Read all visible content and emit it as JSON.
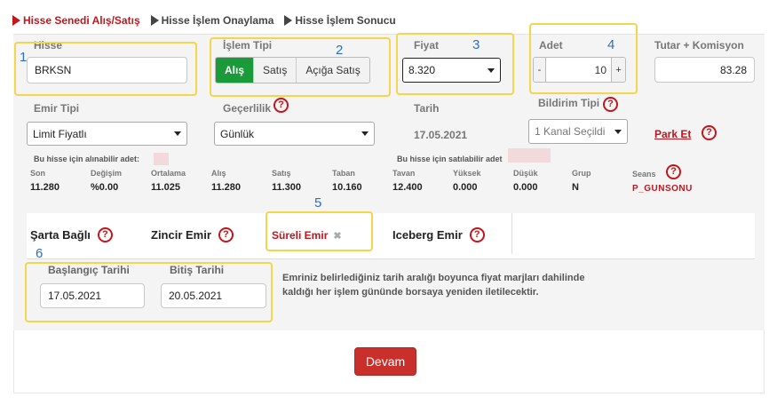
{
  "steps": [
    {
      "label": "Hisse Senedi Alış/Satış"
    },
    {
      "label": "Hisse İşlem Onaylama"
    },
    {
      "label": "Hisse İşlem Sonucu"
    }
  ],
  "form": {
    "hisse_label": "Hisse",
    "hisse_value": "BRKSN",
    "islem_tipi_label": "İşlem Tipi",
    "islem_tipi_options": [
      "Alış",
      "Satış",
      "Açığa Satış"
    ],
    "fiyat_label": "Fiyat",
    "fiyat_value": "8.320",
    "adet_label": "Adet",
    "adet_value": "10",
    "adet_minus": "-",
    "adet_plus": "+",
    "tutar_label": "Tutar + Komisyon",
    "tutar_value": "83.28",
    "emir_tipi_label": "Emir Tipi",
    "emir_tipi_value": "Limit Fiyatlı",
    "gecerlilik_label": "Geçerlilik",
    "gecerlilik_value": "Günlük",
    "tarih_label": "Tarih",
    "tarih_value": "17.05.2021",
    "bildirim_label": "Bildirim Tipi",
    "bildirim_value": "1 Kanal Seçildi",
    "park_et": "Park Et",
    "alinabilir": "Bu hisse için alınabilir adet:",
    "satilabilir": "Bu hisse için satılabilir adet"
  },
  "stats": [
    {
      "h": "Son",
      "v": "11.280"
    },
    {
      "h": "Değişim",
      "v": "%0.00"
    },
    {
      "h": "Ortalama",
      "v": "11.025"
    },
    {
      "h": "Alış",
      "v": "11.280"
    },
    {
      "h": "Satış",
      "v": "11.300"
    },
    {
      "h": "Taban",
      "v": "10.160"
    },
    {
      "h": "Tavan",
      "v": "12.400"
    },
    {
      "h": "Yüksek",
      "v": "0.000"
    },
    {
      "h": "Düşük",
      "v": "0.000"
    },
    {
      "h": "Grup",
      "v": "N"
    }
  ],
  "seans": {
    "label": "Seans",
    "value": "P_GUNSONU"
  },
  "tabs": {
    "sarta": "Şarta Bağlı",
    "zincir": "Zincir Emir",
    "sureli": "Süreli Emir",
    "iceberg": "Iceberg Emir",
    "close": "✖"
  },
  "sureli": {
    "baslangic_label": "Başlangıç Tarihi",
    "baslangic_value": "17.05.2021",
    "bitis_label": "Bitiş Tarihi",
    "bitis_value": "20.05.2021",
    "note_line1": "Emriniz belirlediğiniz tarih aralığı boyunca fiyat marjları dahilinde",
    "note_line2": "kaldığı her işlem gününde borsaya yeniden iletilecektir."
  },
  "annotations": [
    "1",
    "2",
    "3",
    "4",
    "5",
    "6"
  ],
  "devam": "Devam",
  "help": "?",
  "colors": {
    "accent_red": "#c0161c",
    "active_green": "#1b9a3a",
    "highlight": "#f5d54a",
    "button_red": "#c9302c"
  }
}
